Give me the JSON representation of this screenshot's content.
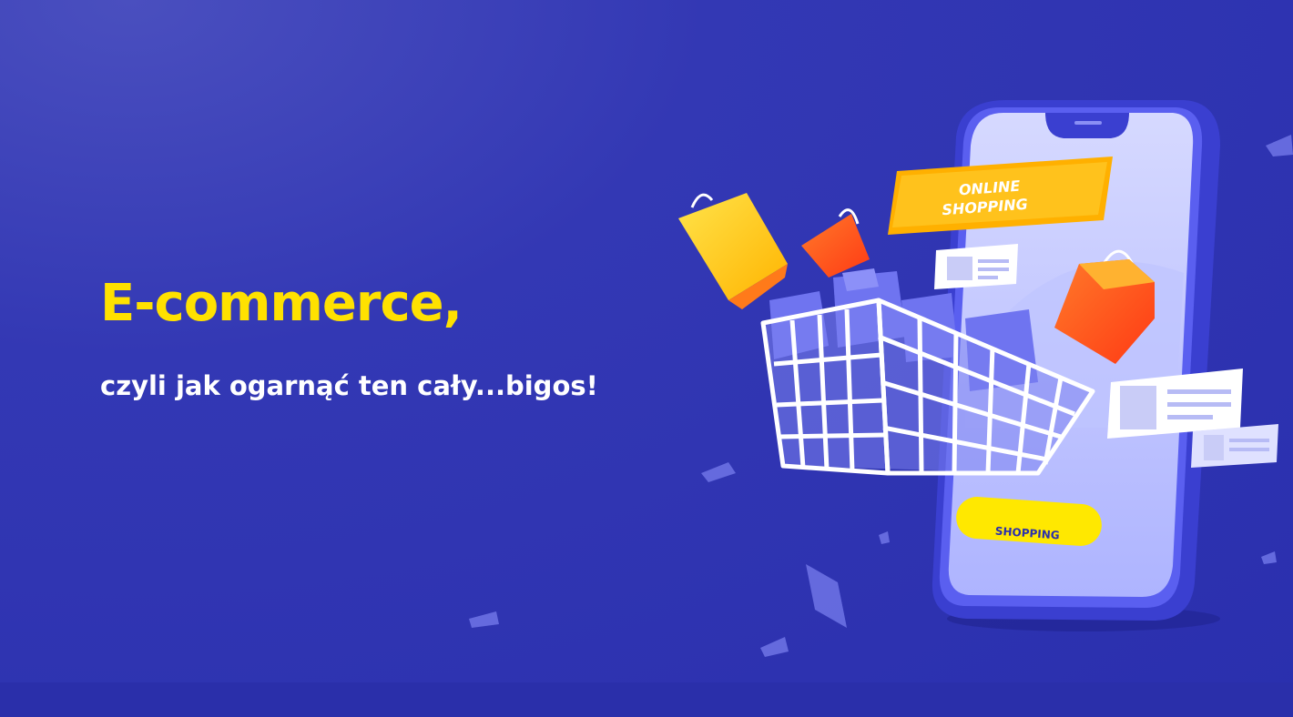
{
  "hero": {
    "headline": "E-commerce,",
    "subheadline": "czyli jak ogarnąć ten cały...bigos!"
  },
  "illustration": {
    "sign_line1": "ONLINE",
    "sign_line2": "SHOPPING",
    "phone_button_label": "SHOPPING"
  },
  "colors": {
    "background": "#2f34b0",
    "accent_yellow": "#ffe100",
    "bag_red": "#ff4a1c",
    "phone_body": "#3a3fd0",
    "phone_screen": "#c7ccff"
  }
}
